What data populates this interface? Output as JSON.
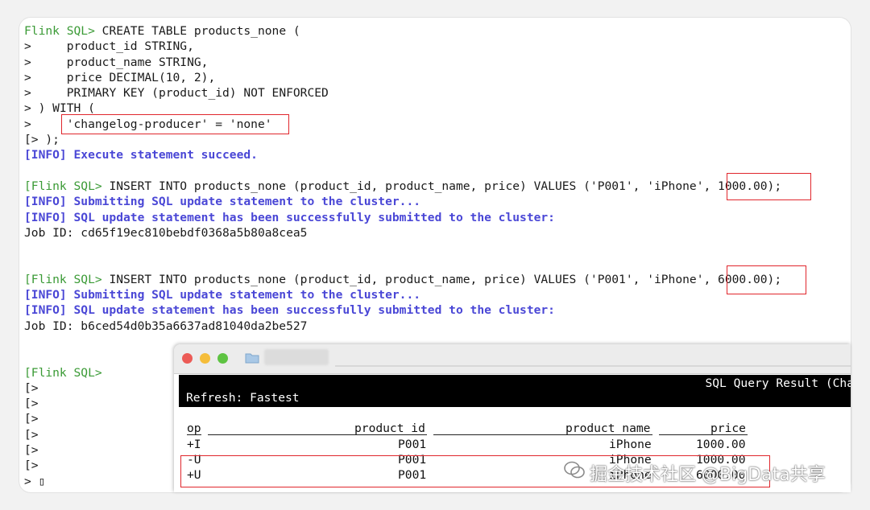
{
  "terminal": {
    "lines": [
      {
        "prompt": "Flink SQL>",
        "text": " CREATE TABLE products_none ("
      },
      {
        "prompt": ">",
        "text": "     product_id STRING,"
      },
      {
        "prompt": ">",
        "text": "     product_name STRING,"
      },
      {
        "prompt": ">",
        "text": "     price DECIMAL(10, 2),"
      },
      {
        "prompt": ">",
        "text": "     PRIMARY KEY (product_id) NOT ENFORCED"
      },
      {
        "prompt": ">",
        "text": " ) WITH ("
      },
      {
        "prompt": ">",
        "text": "     'changelog-producer' = 'none'"
      },
      {
        "prompt": "[> ",
        "text": ");"
      },
      {
        "info": "[INFO] Execute statement succeed."
      },
      {
        "blank": ""
      },
      {
        "prompt2": "[Flink SQL>",
        "text": " INSERT INTO products_none (product_id, product_name, price) VALUES ('P001', 'iPhone', 1000.00);"
      },
      {
        "info": "[INFO] Submitting SQL update statement to the cluster..."
      },
      {
        "info": "[INFO] SQL update statement has been successfully submitted to the cluster:"
      },
      {
        "plain": "Job ID: cd65f19ec810bebdf0368a5b80a8cea5"
      },
      {
        "blank": ""
      },
      {
        "blank": ""
      },
      {
        "prompt2": "[Flink SQL>",
        "text": " INSERT INTO products_none (product_id, product_name, price) VALUES ('P001', 'iPhone', 6000.00);"
      },
      {
        "info": "[INFO] Submitting SQL update statement to the cluster..."
      },
      {
        "info": "[INFO] SQL update statement has been successfully submitted to the cluster:"
      },
      {
        "plain": "Job ID: b6ced54d0b35a6637ad81040da2be527"
      },
      {
        "blank": ""
      },
      {
        "blank": ""
      },
      {
        "prompt2": "[Flink SQL>",
        "text": ""
      },
      {
        "plain": "[>"
      },
      {
        "plain": "[>"
      },
      {
        "plain": "[>"
      },
      {
        "plain": "[>"
      },
      {
        "plain": "[>"
      },
      {
        "plain": "[>"
      },
      {
        "plain": "> ▯"
      }
    ]
  },
  "result_window": {
    "title": "SQL Query Result (Cha",
    "refresh": "Refresh: Fastest",
    "columns": [
      "op",
      "product_id",
      "product_name",
      "price"
    ],
    "rows": [
      [
        "+I",
        "P001",
        "iPhone",
        "1000.00"
      ],
      [
        "-U",
        "P001",
        "iPhone",
        "1000.00"
      ],
      [
        "+U",
        "P001",
        "iPhone",
        "6000.00"
      ]
    ]
  },
  "watermark": "掘金技术社区 @BigData共享",
  "colors": {
    "prompt": "#3a9a35",
    "info": "#4a47d6",
    "highlight": "#e0262c"
  }
}
